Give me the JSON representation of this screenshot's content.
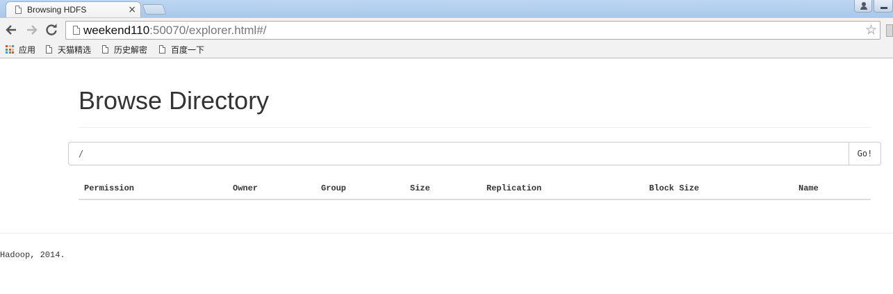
{
  "browser": {
    "tab_title": "Browsing HDFS",
    "tab_close": "×",
    "url_host": "weekend110",
    "url_rest": ":50070/explorer.html#/",
    "bookmarks": [
      {
        "label": "应用"
      },
      {
        "label": "天猫精选"
      },
      {
        "label": "历史解密"
      },
      {
        "label": "百度一下"
      }
    ],
    "apps_colors": [
      "#e8453c",
      "#f9bb2d",
      "#4a89f3",
      "#3aa757",
      "#e8453c",
      "#f9bb2d",
      "#4a89f3",
      "#3aa757",
      "#e8453c"
    ]
  },
  "page": {
    "title": "Browse Directory",
    "path_value": "/",
    "go_label": "Go!",
    "table": {
      "columns": [
        "Permission",
        "Owner",
        "Group",
        "Size",
        "Replication",
        "Block Size",
        "Name"
      ]
    },
    "footer": "Hadoop, 2014."
  }
}
